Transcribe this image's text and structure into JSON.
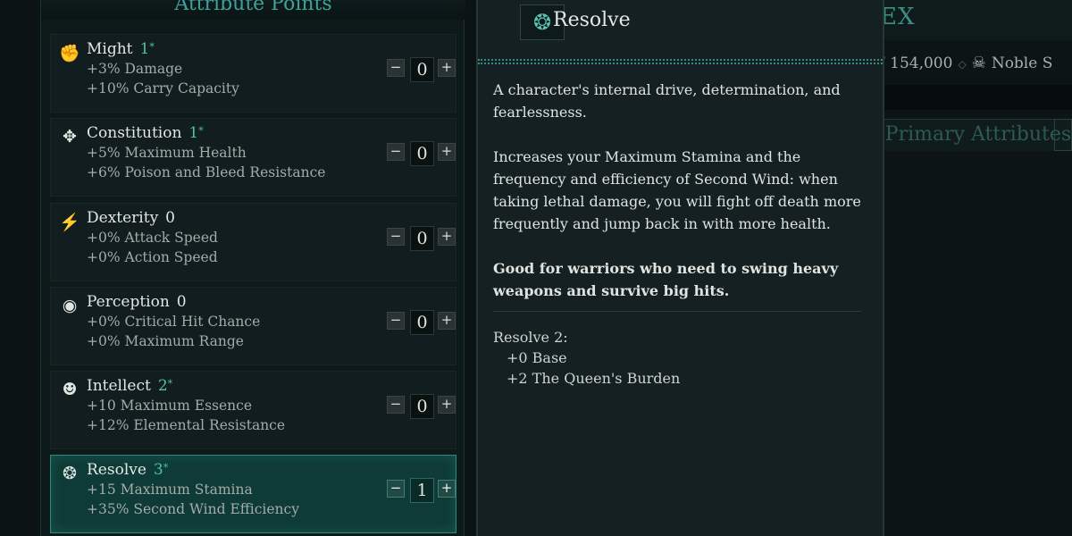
{
  "left_panel": {
    "title": "Attribute Points",
    "attributes": [
      {
        "name": "Might",
        "value": "1",
        "star": "*",
        "boosted": true,
        "line1": "+3% Damage",
        "line2": "+10% Carry Capacity",
        "points": "0",
        "icon": "fist-icon"
      },
      {
        "name": "Constitution",
        "value": "1",
        "star": "*",
        "boosted": true,
        "line1": "+5% Maximum Health",
        "line2": "+6% Poison and Bleed Resistance",
        "points": "0",
        "icon": "figure-icon"
      },
      {
        "name": "Dexterity",
        "value": "0",
        "star": "",
        "boosted": false,
        "line1": "+0% Attack Speed",
        "line2": "+0% Action Speed",
        "points": "0",
        "icon": "running-icon"
      },
      {
        "name": "Perception",
        "value": "0",
        "star": "",
        "boosted": false,
        "line1": "+0% Critical Hit Chance",
        "line2": "+0% Maximum Range",
        "points": "0",
        "icon": "eye-icon"
      },
      {
        "name": "Intellect",
        "value": "2",
        "star": "*",
        "boosted": true,
        "line1": "+10 Maximum Essence",
        "line2": "+12% Elemental Resistance",
        "points": "0",
        "icon": "head-icon"
      },
      {
        "name": "Resolve",
        "value": "3",
        "star": "*",
        "boosted": true,
        "selected": true,
        "line1": "+15 Maximum Stamina",
        "line2": "+35% Second Wind Efficiency",
        "points": "1",
        "icon": "resolve-icon"
      }
    ],
    "minus_label": "−",
    "plus_label": "+"
  },
  "tooltip": {
    "title": "Resolve",
    "icon": "resolve-icon",
    "description": "A character's internal drive, determination, and fearlessness.",
    "effect": "Increases your Maximum Stamina and the frequency and efficiency of Second Wind: when taking lethal damage, you will fight off death more frequently and jump back in with more health.",
    "advice": "Good for warriors who need to swing heavy weapons and survive big hits.",
    "breakdown_title": "Resolve 2:",
    "breakdown_lines": [
      "+0 Base",
      "+2 The Queen's Burden"
    ]
  },
  "background": {
    "title": "EX",
    "currency": "/ 154,000",
    "rank": "Noble S",
    "section_title": "Primary Attributes"
  },
  "colors": {
    "accent": "#3da39a",
    "boost": "#4fc1a9",
    "selected_bg": "#0e3b37"
  }
}
